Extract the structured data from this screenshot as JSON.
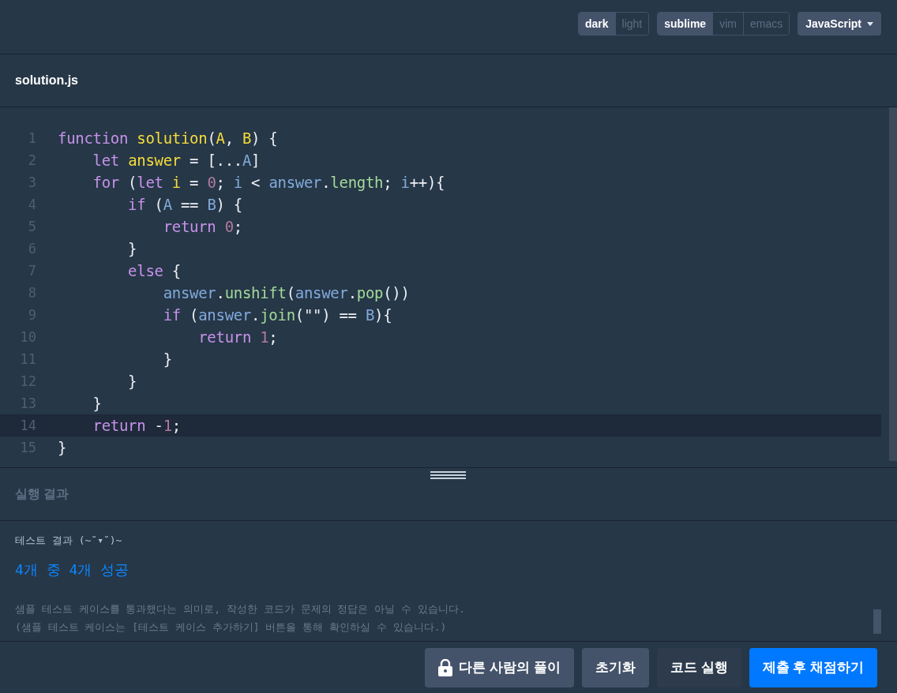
{
  "toolbar": {
    "themes": [
      {
        "label": "dark",
        "selected": true
      },
      {
        "label": "light",
        "selected": false
      }
    ],
    "keymaps": [
      {
        "label": "sublime",
        "selected": true
      },
      {
        "label": "vim",
        "selected": false
      },
      {
        "label": "emacs",
        "selected": false
      }
    ],
    "language": "JavaScript"
  },
  "file_tab": {
    "name": "solution.js"
  },
  "editor": {
    "lines": [
      {
        "number": "1",
        "active": false,
        "tokens": [
          {
            "kind": "keyword",
            "text": "function "
          },
          {
            "kind": "def",
            "text": "solution"
          },
          {
            "kind": "plain",
            "text": "("
          },
          {
            "kind": "def",
            "text": "A"
          },
          {
            "kind": "plain",
            "text": ", "
          },
          {
            "kind": "def",
            "text": "B"
          },
          {
            "kind": "plain",
            "text": ") {"
          }
        ]
      },
      {
        "number": "2",
        "active": false,
        "tokens": [
          {
            "kind": "keyword",
            "text": "    let "
          },
          {
            "kind": "def",
            "text": "answer"
          },
          {
            "kind": "plain",
            "text": " = [..."
          },
          {
            "kind": "variable",
            "text": "A"
          },
          {
            "kind": "plain",
            "text": "]"
          }
        ]
      },
      {
        "number": "3",
        "active": false,
        "tokens": [
          {
            "kind": "keyword",
            "text": "    for"
          },
          {
            "kind": "plain",
            "text": " ("
          },
          {
            "kind": "keyword",
            "text": "let "
          },
          {
            "kind": "def",
            "text": "i"
          },
          {
            "kind": "plain",
            "text": " = "
          },
          {
            "kind": "number",
            "text": "0"
          },
          {
            "kind": "plain",
            "text": "; "
          },
          {
            "kind": "variable",
            "text": "i"
          },
          {
            "kind": "plain",
            "text": " < "
          },
          {
            "kind": "variable",
            "text": "answer"
          },
          {
            "kind": "plain",
            "text": "."
          },
          {
            "kind": "property",
            "text": "length"
          },
          {
            "kind": "plain",
            "text": "; "
          },
          {
            "kind": "variable",
            "text": "i"
          },
          {
            "kind": "plain",
            "text": "++){"
          }
        ]
      },
      {
        "number": "4",
        "active": false,
        "tokens": [
          {
            "kind": "keyword",
            "text": "        if"
          },
          {
            "kind": "plain",
            "text": " ("
          },
          {
            "kind": "variable",
            "text": "A"
          },
          {
            "kind": "plain",
            "text": " == "
          },
          {
            "kind": "variable",
            "text": "B"
          },
          {
            "kind": "plain",
            "text": ") {"
          }
        ]
      },
      {
        "number": "5",
        "active": false,
        "tokens": [
          {
            "kind": "keyword",
            "text": "            return "
          },
          {
            "kind": "number",
            "text": "0"
          },
          {
            "kind": "plain",
            "text": ";"
          }
        ]
      },
      {
        "number": "6",
        "active": false,
        "tokens": [
          {
            "kind": "plain",
            "text": "        }"
          }
        ]
      },
      {
        "number": "7",
        "active": false,
        "tokens": [
          {
            "kind": "keyword",
            "text": "        else"
          },
          {
            "kind": "plain",
            "text": " {"
          }
        ]
      },
      {
        "number": "8",
        "active": false,
        "tokens": [
          {
            "kind": "variable",
            "text": "            answer"
          },
          {
            "kind": "plain",
            "text": "."
          },
          {
            "kind": "property",
            "text": "unshift"
          },
          {
            "kind": "plain",
            "text": "("
          },
          {
            "kind": "variable",
            "text": "answer"
          },
          {
            "kind": "plain",
            "text": "."
          },
          {
            "kind": "property",
            "text": "pop"
          },
          {
            "kind": "plain",
            "text": "())"
          }
        ]
      },
      {
        "number": "9",
        "active": false,
        "tokens": [
          {
            "kind": "keyword",
            "text": "            if"
          },
          {
            "kind": "plain",
            "text": " ("
          },
          {
            "kind": "variable",
            "text": "answer"
          },
          {
            "kind": "plain",
            "text": "."
          },
          {
            "kind": "property",
            "text": "join"
          },
          {
            "kind": "plain",
            "text": "(\"\") == "
          },
          {
            "kind": "variable",
            "text": "B"
          },
          {
            "kind": "plain",
            "text": "){"
          }
        ]
      },
      {
        "number": "10",
        "active": false,
        "tokens": [
          {
            "kind": "keyword",
            "text": "                return "
          },
          {
            "kind": "number",
            "text": "1"
          },
          {
            "kind": "plain",
            "text": ";"
          }
        ]
      },
      {
        "number": "11",
        "active": false,
        "tokens": [
          {
            "kind": "plain",
            "text": "            }"
          }
        ]
      },
      {
        "number": "12",
        "active": false,
        "tokens": [
          {
            "kind": "plain",
            "text": "        }"
          }
        ]
      },
      {
        "number": "13",
        "active": false,
        "tokens": [
          {
            "kind": "plain",
            "text": "    }"
          }
        ]
      },
      {
        "number": "14",
        "active": true,
        "tokens": [
          {
            "kind": "keyword",
            "text": "    return"
          },
          {
            "kind": "plain",
            "text": " -"
          },
          {
            "kind": "number",
            "text": "1"
          },
          {
            "kind": "plain",
            "text": ";"
          }
        ]
      },
      {
        "number": "15",
        "active": false,
        "tokens": [
          {
            "kind": "plain",
            "text": "}"
          }
        ]
      }
    ]
  },
  "result": {
    "title": "실행 결과",
    "test_heading": "테스트 결과 (~˘▾˘)~",
    "summary": "4개 중 4개 성공",
    "notes": [
      "샘플 테스트 케이스를 통과했다는 의미로, 작성한 코드가 문제의 정답은 아닐 수 있습니다.",
      "(샘플 테스트 케이스는 [테스트 케이스 추가하기] 버튼을 통해 확인하실 수 있습니다.)"
    ]
  },
  "buttons": [
    {
      "label": "다른 사람의 풀이",
      "kind": "locked"
    },
    {
      "label": "초기화",
      "kind": "secondary"
    },
    {
      "label": "코드 실행",
      "kind": "dark"
    },
    {
      "label": "제출 후 채점하기",
      "kind": "primary"
    }
  ]
}
